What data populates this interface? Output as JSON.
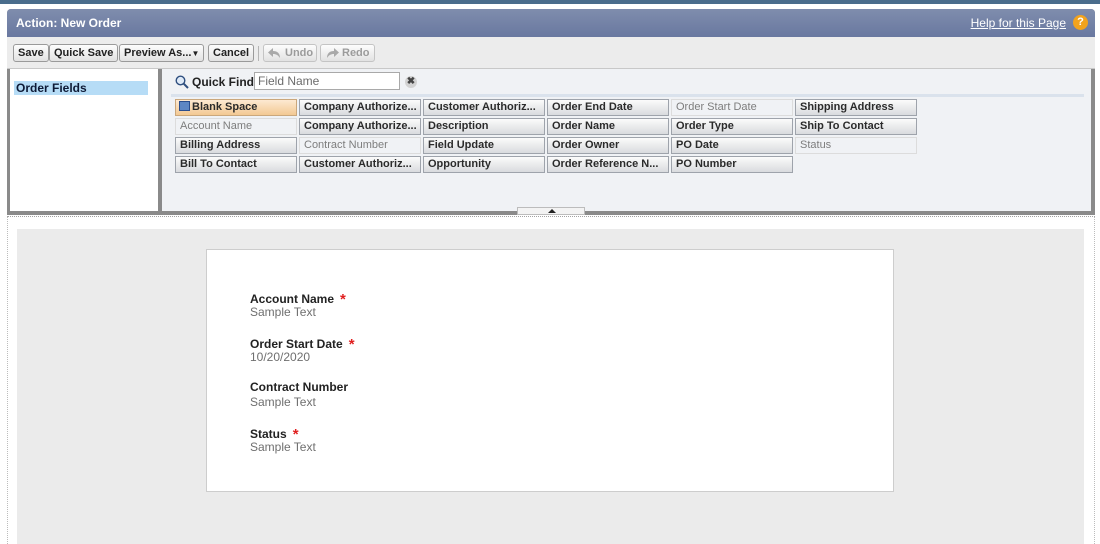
{
  "header": {
    "title": "Action: New Order",
    "help_link": "Help for this Page",
    "help_icon": "?"
  },
  "toolbar": {
    "save": "Save",
    "quick_save": "Quick Save",
    "preview": "Preview As...",
    "preview_arrow": "▼",
    "cancel": "Cancel",
    "undo": "Undo",
    "redo": "Redo"
  },
  "sidebar": {
    "items": [
      {
        "label": "Order Fields",
        "selected": true
      }
    ]
  },
  "quick_find": {
    "label": "Quick Find",
    "placeholder": "Field Name",
    "clear_icon": "✖"
  },
  "palette": {
    "fields": [
      {
        "label": "Blank Space",
        "state": "blank"
      },
      {
        "label": "Account Name",
        "state": "used"
      },
      {
        "label": "Billing Address",
        "state": "available"
      },
      {
        "label": "Bill To Contact",
        "state": "available"
      },
      {
        "label": "Company Authorize...",
        "state": "available"
      },
      {
        "label": "Company Authorize...",
        "state": "available"
      },
      {
        "label": "Contract Number",
        "state": "used"
      },
      {
        "label": "Customer Authoriz...",
        "state": "available"
      },
      {
        "label": "Customer Authoriz...",
        "state": "available"
      },
      {
        "label": "Description",
        "state": "available"
      },
      {
        "label": "Field Update",
        "state": "available"
      },
      {
        "label": "Opportunity",
        "state": "available"
      },
      {
        "label": "Order End Date",
        "state": "available"
      },
      {
        "label": "Order Name",
        "state": "available"
      },
      {
        "label": "Order Owner",
        "state": "available"
      },
      {
        "label": "Order Reference N...",
        "state": "available"
      },
      {
        "label": "Order Start Date",
        "state": "used"
      },
      {
        "label": "Order Type",
        "state": "available"
      },
      {
        "label": "PO Date",
        "state": "available"
      },
      {
        "label": "PO Number",
        "state": "available"
      },
      {
        "label": "Shipping Address",
        "state": "available"
      },
      {
        "label": "Ship To Contact",
        "state": "available"
      },
      {
        "label": "Status",
        "state": "used"
      }
    ]
  },
  "layout": {
    "fields": [
      {
        "label": "Account Name",
        "value": "Sample Text",
        "required": true
      },
      {
        "label": "Order Start Date",
        "value": "10/20/2020",
        "required": true
      },
      {
        "label": "Contract Number",
        "value": "Sample Text",
        "required": false
      },
      {
        "label": "Status",
        "value": "Sample Text",
        "required": true
      }
    ],
    "required_marker": "*"
  },
  "colors": {
    "title_bar": "#6978a0",
    "selected_item": "#b6dcf6",
    "required": "#e01f1f",
    "help_icon": "#f2a31d"
  }
}
